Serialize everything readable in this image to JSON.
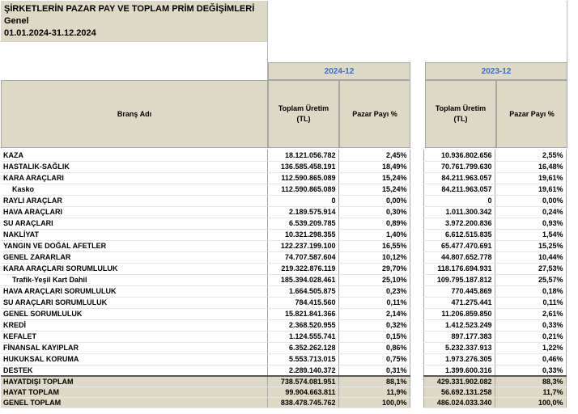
{
  "header": {
    "title": "ŞİRKETLERİN PAZAR PAY VE TOPLAM PRİM DEĞİŞİMLERİ",
    "subtitle": "Genel",
    "date_range": "01.01.2024-31.12.2024"
  },
  "periods": {
    "current": "2024-12",
    "previous": "2023-12"
  },
  "columns": {
    "branch": "Branş Adı",
    "total_production": "Toplam Üretim (TL)",
    "market_share": "Pazar Payı %"
  },
  "rows": [
    {
      "name": "KAZA",
      "sub": false,
      "p24": "18.121.056.782",
      "s24": "2,45%",
      "p23": "10.936.802.656",
      "s23": "2,55%"
    },
    {
      "name": "HASTALIK-SAĞLIK",
      "sub": false,
      "p24": "136.585.458.191",
      "s24": "18,49%",
      "p23": "70.761.799.630",
      "s23": "16,48%"
    },
    {
      "name": "KARA ARAÇLARI",
      "sub": false,
      "p24": "112.590.865.089",
      "s24": "15,24%",
      "p23": "84.211.963.057",
      "s23": "19,61%"
    },
    {
      "name": "Kasko",
      "sub": true,
      "p24": "112.590.865.089",
      "s24": "15,24%",
      "p23": "84.211.963.057",
      "s23": "19,61%"
    },
    {
      "name": "RAYLI ARAÇLAR",
      "sub": false,
      "p24": "0",
      "s24": "0,00%",
      "p23": "0",
      "s23": "0,00%"
    },
    {
      "name": "HAVA ARAÇLARI",
      "sub": false,
      "p24": "2.189.575.914",
      "s24": "0,30%",
      "p23": "1.011.300.342",
      "s23": "0,24%"
    },
    {
      "name": "SU ARAÇLARI",
      "sub": false,
      "p24": "6.539.209.785",
      "s24": "0,89%",
      "p23": "3.972.200.836",
      "s23": "0,93%"
    },
    {
      "name": "NAKLİYAT",
      "sub": false,
      "p24": "10.321.298.355",
      "s24": "1,40%",
      "p23": "6.612.515.835",
      "s23": "1,54%"
    },
    {
      "name": "YANGIN VE DOĞAL AFETLER",
      "sub": false,
      "p24": "122.237.199.100",
      "s24": "16,55%",
      "p23": "65.477.470.691",
      "s23": "15,25%"
    },
    {
      "name": "GENEL ZARARLAR",
      "sub": false,
      "p24": "74.707.587.604",
      "s24": "10,12%",
      "p23": "44.807.652.778",
      "s23": "10,44%"
    },
    {
      "name": "KARA ARAÇLARI SORUMLULUK",
      "sub": false,
      "p24": "219.322.876.119",
      "s24": "29,70%",
      "p23": "118.176.694.931",
      "s23": "27,53%"
    },
    {
      "name": "Trafik-Yeşil Kart Dahil",
      "sub": true,
      "p24": "185.394.028.461",
      "s24": "25,10%",
      "p23": "109.795.187.812",
      "s23": "25,57%"
    },
    {
      "name": "HAVA ARAÇLARI SORUMLULUK",
      "sub": false,
      "p24": "1.664.505.875",
      "s24": "0,23%",
      "p23": "770.445.869",
      "s23": "0,18%"
    },
    {
      "name": "SU ARAÇLARI SORUMLULUK",
      "sub": false,
      "p24": "784.415.560",
      "s24": "0,11%",
      "p23": "471.275.441",
      "s23": "0,11%"
    },
    {
      "name": "GENEL SORUMLULUK",
      "sub": false,
      "p24": "15.821.841.366",
      "s24": "2,14%",
      "p23": "11.206.859.850",
      "s23": "2,61%"
    },
    {
      "name": "KREDİ",
      "sub": false,
      "p24": "2.368.520.955",
      "s24": "0,32%",
      "p23": "1.412.523.249",
      "s23": "0,33%"
    },
    {
      "name": "KEFALET",
      "sub": false,
      "p24": "1.124.555.741",
      "s24": "0,15%",
      "p23": "897.177.383",
      "s23": "0,21%"
    },
    {
      "name": "FİNANSAL KAYIPLAR",
      "sub": false,
      "p24": "6.352.262.128",
      "s24": "0,86%",
      "p23": "5.232.337.913",
      "s23": "1,22%"
    },
    {
      "name": "HUKUKSAL KORUMA",
      "sub": false,
      "p24": "5.553.713.015",
      "s24": "0,75%",
      "p23": "1.973.276.305",
      "s23": "0,46%"
    },
    {
      "name": "DESTEK",
      "sub": false,
      "p24": "2.289.140.372",
      "s24": "0,31%",
      "p23": "1.399.600.316",
      "s23": "0,33%"
    }
  ],
  "totals": [
    {
      "name": "HAYATDIŞI TOPLAM",
      "p24": "738.574.081.951",
      "s24": "88,1%",
      "p23": "429.331.902.082",
      "s23": "88,3%"
    },
    {
      "name": "HAYAT TOPLAM",
      "p24": "99.904.663.811",
      "s24": "11,9%",
      "p23": "56.692.131.258",
      "s23": "11,7%"
    },
    {
      "name": "GENEL TOPLAM",
      "p24": "838.478.745.762",
      "s24": "100,0%",
      "p23": "486.024.033.340",
      "s23": "100,0%"
    }
  ]
}
